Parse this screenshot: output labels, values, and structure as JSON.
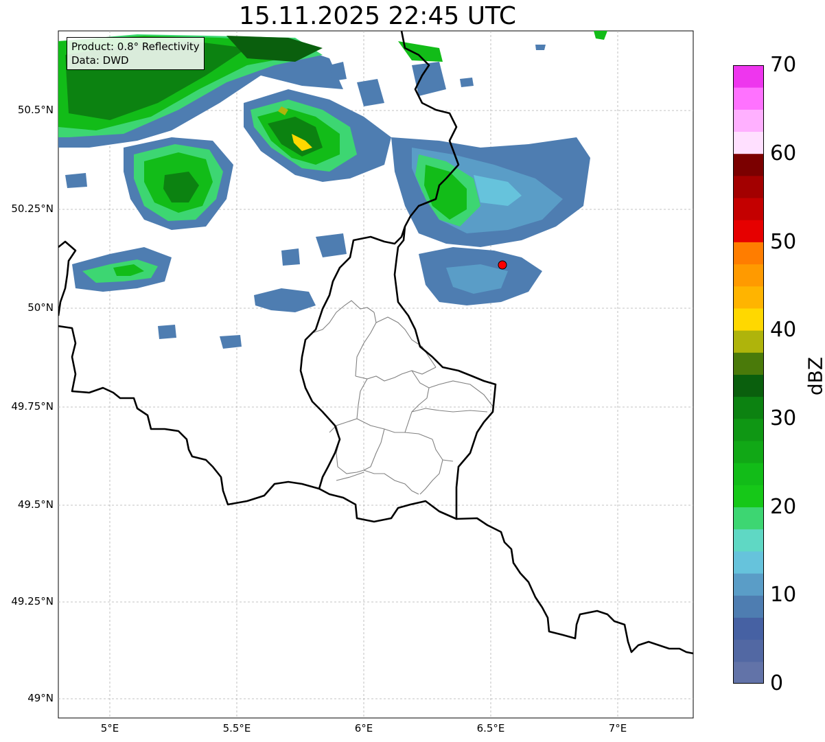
{
  "title": "15.11.2025 22:45 UTC",
  "info": {
    "product": "Product: 0.8° Reflectivity",
    "data": "Data: DWD"
  },
  "axes": {
    "lat_ticks": [
      "50.5°N",
      "50.25°N",
      "50°N",
      "49.75°N",
      "49.5°N",
      "49.25°N",
      "49°N"
    ],
    "lon_ticks": [
      "5°E",
      "5.5°E",
      "6°E",
      "6.5°E",
      "7°E"
    ]
  },
  "colorbar": {
    "label": "dBZ",
    "ticks": [
      "0",
      "10",
      "20",
      "30",
      "40",
      "50",
      "60",
      "70"
    ],
    "range": [
      0,
      70
    ],
    "colors": [
      "#6273a8",
      "#5268a3",
      "#4661a3",
      "#4e7db1",
      "#5a9dc7",
      "#66c3dc",
      "#5fd8c4",
      "#3dd672",
      "#16c818",
      "#12bc18",
      "#11a816",
      "#0f9714",
      "#0c8211",
      "#0a5f0d",
      "#4a7a0a",
      "#afb40b",
      "#ffd800",
      "#ffb400",
      "#ff9a00",
      "#ff7d00",
      "#e60000",
      "#c40000",
      "#a30000",
      "#7b0000",
      "#ffe0ff",
      "#ffb0ff",
      "#ff72ff",
      "#ee36ee"
    ]
  },
  "location_marker": {
    "lon": 6.55,
    "lat": 50.11,
    "color": "#ff0000"
  }
}
